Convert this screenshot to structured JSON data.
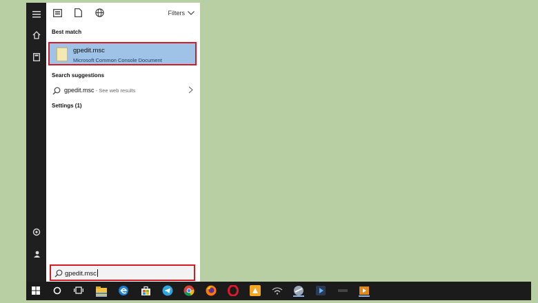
{
  "topbar": {
    "filters_label": "Filters"
  },
  "sections": {
    "best_match": "Best match",
    "search_suggestions": "Search suggestions",
    "settings": "Settings (1)"
  },
  "best_match_item": {
    "title": "gpedit.msc",
    "subtitle": "Microsoft Common Console Document"
  },
  "suggestion": {
    "text": "gpedit.msc",
    "hint": " - See web results"
  },
  "search": {
    "value": "gpedit.msc"
  },
  "taskbar": {
    "items": [
      "start-icon",
      "cortana-icon",
      "task-view-icon",
      "file-explorer-icon",
      "edge-icon",
      "store-icon",
      "telegram-icon",
      "chrome-icon",
      "firefox-icon",
      "opera-icon",
      "app-icon",
      "wifi-icon",
      "app-icon-2",
      "media-icon",
      "app-icon-3",
      "movie-icon"
    ]
  },
  "colors": {
    "highlight": "#9ec3e6",
    "annotation": "#d71a21",
    "background": "#b7cfa3"
  }
}
